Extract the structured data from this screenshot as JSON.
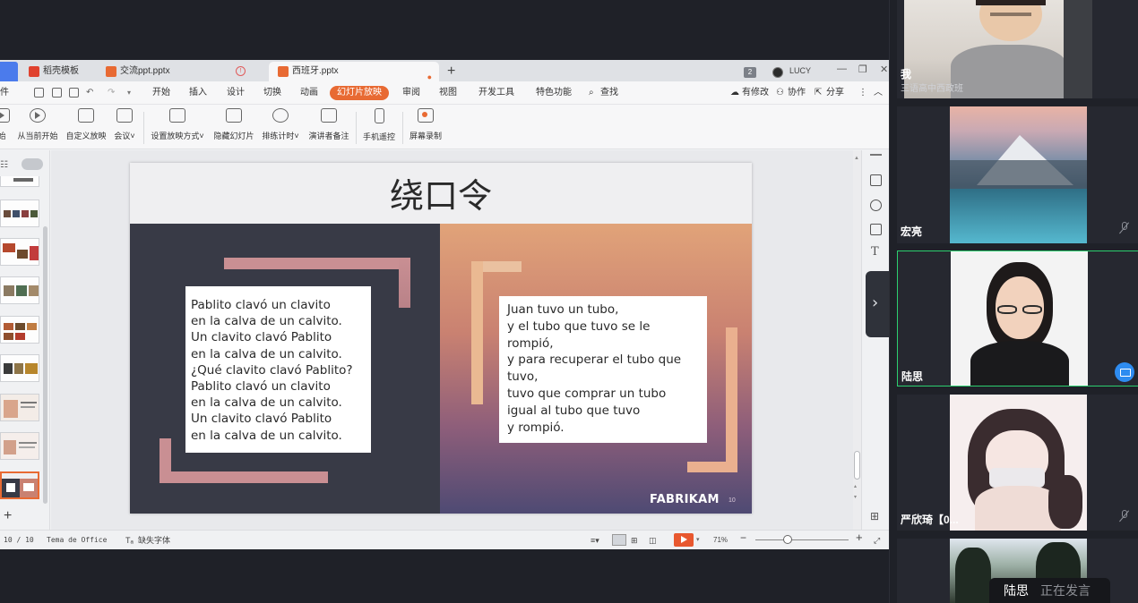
{
  "tabs": [
    {
      "label": "稻壳模板",
      "icon_color": "#e0422f"
    },
    {
      "label": "交流ppt.pptx",
      "icon_color": "#e86a33"
    },
    {
      "label": "西班牙.pptx",
      "icon_color": "#e86a33"
    }
  ],
  "window": {
    "badge": "2",
    "user": "LUCY"
  },
  "menu": {
    "file": "件",
    "items": [
      "开始",
      "插入",
      "设计",
      "切换",
      "动画",
      "幻灯片放映",
      "审阅",
      "视图",
      "开发工具",
      "特色功能"
    ],
    "search": "查找",
    "right": [
      "有修改",
      "协作",
      "分享"
    ]
  },
  "ribbon": [
    "始",
    "从当前开始",
    "自定义放映",
    "会议",
    "设置放映方式",
    "隐藏幻灯片",
    "排练计时",
    "演讲者备注",
    "手机遥控",
    "屏幕录制"
  ],
  "slide": {
    "title": "绕口令",
    "left_lines": [
      "Pablito clavó un clavito",
      "en la calva de un calvito.",
      "Un clavito clavó Pablito",
      "en la calva de un calvito.",
      "¿Qué clavito clavó Pablito?",
      "Pablito clavó un clavito",
      "en la calva de un calvito.",
      "Un clavito clavó Pablito",
      "en la calva de un calvito."
    ],
    "right_lines": [
      "Juan tuvo un tubo,",
      "y el tubo que tuvo se le",
      "rompió,",
      "y para recuperar el tubo que",
      "tuvo,",
      "tuvo que comprar un tubo",
      "igual al tubo que tuvo",
      "y rompió."
    ],
    "brand": "FABRIKAM",
    "page": "10"
  },
  "status": {
    "page": "10 / 10",
    "theme": "Tema de Office",
    "font": "缺失字体",
    "zoom": "71%"
  },
  "participants": [
    {
      "name": "我",
      "subtitle": "三语高中西政班"
    },
    {
      "name": "宏亮"
    },
    {
      "name": "陆思"
    },
    {
      "name": "严欣琦【0..."
    }
  ],
  "speaking": {
    "name": "陆思",
    "status": "正在发言"
  }
}
